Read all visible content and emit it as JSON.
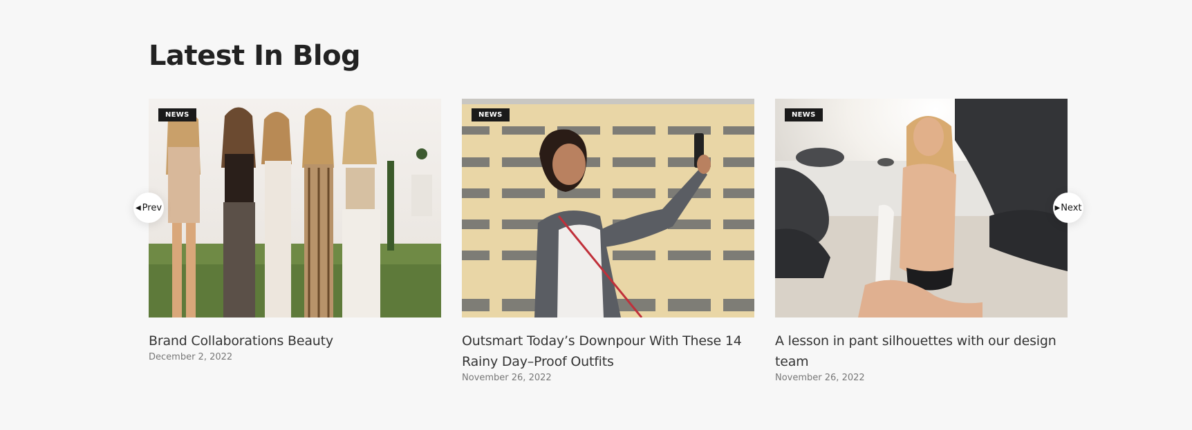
{
  "section": {
    "title": "Latest In Blog"
  },
  "nav": {
    "prev_label": "Prev",
    "next_label": "Next",
    "prev_icon": "caret-left-icon",
    "next_icon": "caret-right-icon"
  },
  "posts": [
    {
      "badge": "NEWS",
      "title": "Brand Collaborations Beauty",
      "date": "December 2, 2022"
    },
    {
      "badge": "NEWS",
      "title": "Outsmart Today’s Downpour With These 14 Rainy Day–Proof Outfits",
      "date": "November 26, 2022"
    },
    {
      "badge": "NEWS",
      "title": "A lesson in pant silhouettes with our design team",
      "date": "November 26, 2022"
    }
  ],
  "colors": {
    "background": "#f7f7f7",
    "badge_bg": "#1a1a1a",
    "title": "#333333",
    "date": "#777777"
  }
}
